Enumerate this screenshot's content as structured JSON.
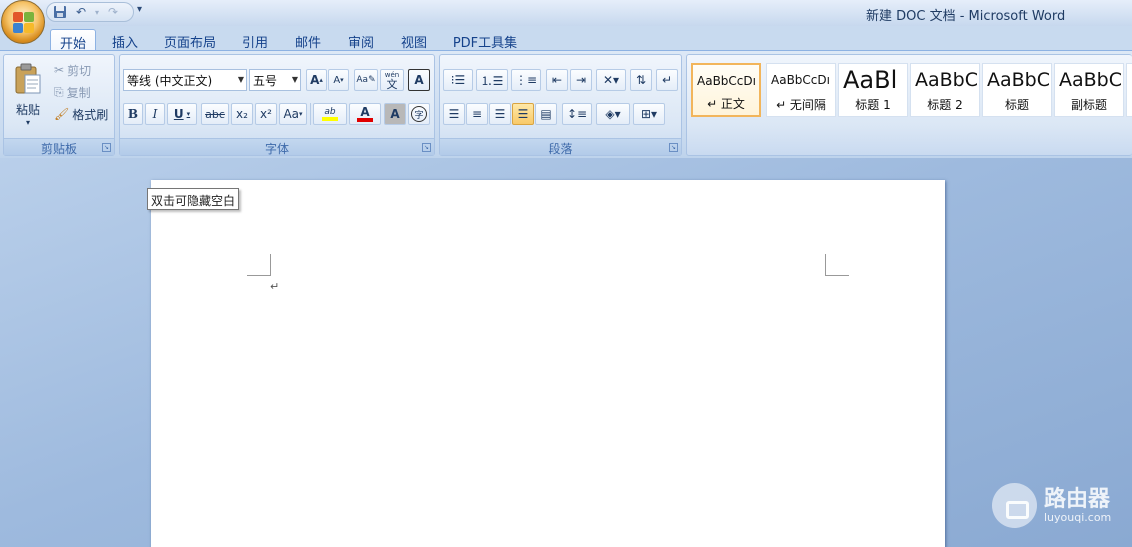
{
  "window": {
    "title": "新建 DOC 文档 - Microsoft Word"
  },
  "quick_access": {
    "save_icon": "save-icon",
    "undo_icon": "undo-icon",
    "redo_icon": "redo-icon",
    "more_glyph": "▾"
  },
  "tabs": [
    {
      "label": "开始",
      "active": true
    },
    {
      "label": "插入"
    },
    {
      "label": "页面布局"
    },
    {
      "label": "引用"
    },
    {
      "label": "邮件"
    },
    {
      "label": "审阅"
    },
    {
      "label": "视图"
    },
    {
      "label": "PDF工具集"
    }
  ],
  "clipboard": {
    "group_label": "剪贴板",
    "paste_label": "粘贴",
    "cut_label": "剪切",
    "copy_label": "复制",
    "format_painter_label": "格式刷"
  },
  "font": {
    "group_label": "字体",
    "font_name": "等线 (中文正文)",
    "font_size": "五号",
    "grow_glyph": "A",
    "shrink_glyph": "A",
    "bold": "B",
    "italic": "I",
    "underline": "U",
    "strikethrough": "abc",
    "subscript": "x₂",
    "superscript": "x²",
    "change_case": "Aa",
    "highlight_glyph": "ab",
    "font_color_glyph": "A",
    "char_shading_glyph": "A",
    "enclose_glyph": "字",
    "phonetic_glyph": "wén",
    "phonetic_char": "文",
    "border_glyph": "A"
  },
  "paragraph": {
    "group_label": "段落"
  },
  "styles": {
    "tiles": [
      {
        "sample": "AaBbCcDı",
        "name": "↵ 正文",
        "active": true
      },
      {
        "sample": "AaBbCcDı",
        "name": "↵ 无间隔"
      },
      {
        "sample": "AaBl",
        "name": "标题 1"
      },
      {
        "sample": "AaBbC",
        "name": "标题 2"
      },
      {
        "sample": "AaBbC",
        "name": "标题"
      },
      {
        "sample": "AaBbC",
        "name": "副标题"
      }
    ]
  },
  "document": {
    "tooltip": "双击可隐藏空白",
    "paragraph_mark": "↵"
  },
  "watermark": {
    "brand": "路由器",
    "url": "luyouqi.com"
  },
  "colors": {
    "highlight": "#ffff00",
    "font_color": "#e00000",
    "accent_selected": "#f2b55b"
  }
}
